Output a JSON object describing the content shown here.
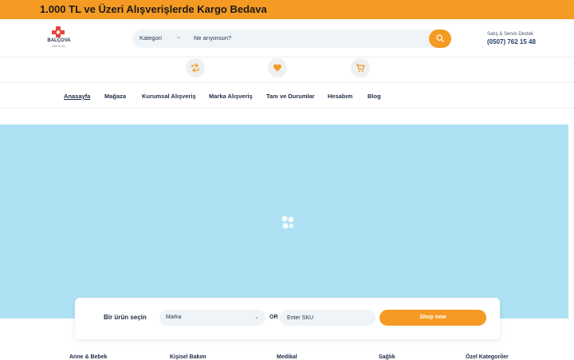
{
  "promo_bar": {
    "text": "1.000 TL ve Üzeri Alışverişlerde Kargo Bedava"
  },
  "header": {
    "logo": {
      "name": "BALÇOVA",
      "sub": "MEDİKAL"
    },
    "search": {
      "category_label": "Kategori",
      "placeholder": "Ne arıyorsun?",
      "icon": "search-icon"
    },
    "support": {
      "label": "Satış & Servis Destek",
      "phone": "(0507) 762 15 48"
    }
  },
  "icon_row": [
    {
      "icon": "compare-icon"
    },
    {
      "icon": "heart-icon"
    },
    {
      "icon": "cart-icon"
    }
  ],
  "nav": {
    "items": [
      {
        "label": "Anasayfa",
        "active": true
      },
      {
        "label": "Mağaza"
      },
      {
        "label": "Kurumsal Alışveriş"
      },
      {
        "label": "Marka Alışveriş"
      },
      {
        "label": "Tanı ve Durumlar"
      },
      {
        "label": "Hesabım"
      },
      {
        "label": "Blog"
      }
    ]
  },
  "hero": {
    "icon": "loading-spinner-icon"
  },
  "product_finder": {
    "label": "Bir ürün seçin",
    "brand_select": "Marka",
    "or_label": "OR",
    "sku_placeholder": "Enter SKU",
    "button_label": "Shop now"
  },
  "footer_categories": [
    "Anne & Bebek",
    "Kişisel Bakım",
    "Medikal",
    "Sağlık",
    "Özel Kategoriler"
  ],
  "colors": {
    "accent": "#f59a23",
    "hero_bg": "#aee1f3",
    "navy": "#1f2a44",
    "input_bg": "#eef4f7"
  }
}
